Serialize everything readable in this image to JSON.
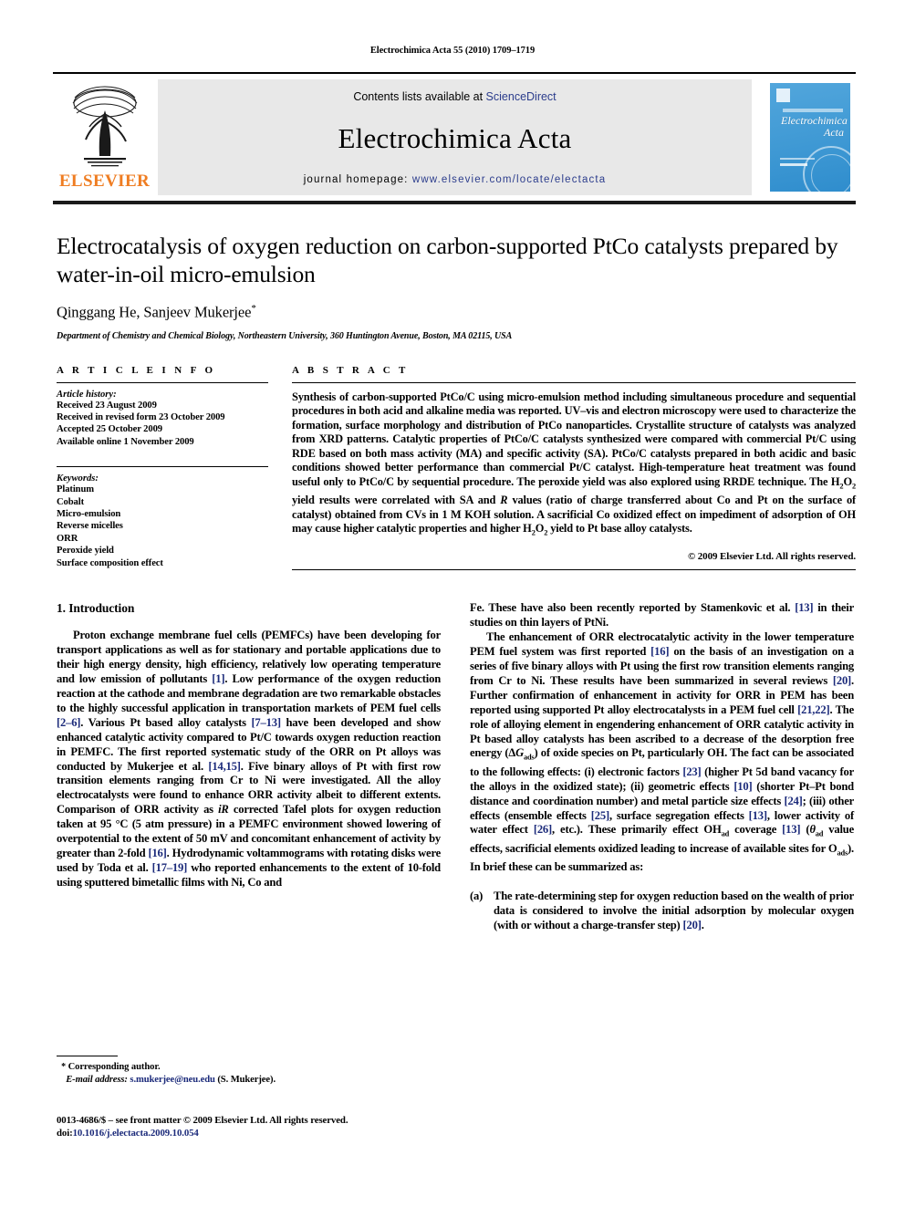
{
  "running_head": "Electrochimica Acta 55 (2010) 1709–1719",
  "masthead": {
    "publisher_name": "ELSEVIER",
    "contents_prefix": "Contents lists available at ",
    "contents_link": "ScienceDirect",
    "journal_title": "Electrochimica Acta",
    "homepage_prefix": "journal homepage: ",
    "homepage_url": "www.elsevier.com/locate/electacta",
    "cover_title_line1": "Electrochimica",
    "cover_title_line2": "Acta"
  },
  "article": {
    "title": "Electrocatalysis of oxygen reduction on carbon-supported PtCo catalysts prepared by water-in-oil micro-emulsion",
    "authors": "Qinggang He, Sanjeev Mukerjee",
    "corresponding_marker": "*",
    "affiliation": "Department of Chemistry and Chemical Biology, Northeastern University, 360 Huntington Avenue, Boston, MA 02115, USA"
  },
  "article_info": {
    "heading": "A R T I C L E   I N F O",
    "history_label": "Article history:",
    "history": [
      "Received 23 August 2009",
      "Received in revised form 23 October 2009",
      "Accepted 25 October 2009",
      "Available online 1 November 2009"
    ],
    "keywords_label": "Keywords:",
    "keywords": [
      "Platinum",
      "Cobalt",
      "Micro-emulsion",
      "Reverse micelles",
      "ORR",
      "Peroxide yield",
      "Surface composition effect"
    ]
  },
  "abstract": {
    "heading": "A B S T R A C T",
    "copyright": "© 2009 Elsevier Ltd. All rights reserved."
  },
  "introduction": {
    "heading": "1.  Introduction",
    "list_marker": "(a)"
  },
  "footnote": {
    "corresponding_star": "*",
    "corresponding_label": "Corresponding author.",
    "email_label": "E-mail address:",
    "email": "s.mukerjee@neu.edu",
    "email_suffix": "(S. Mukerjee)."
  },
  "imprint": {
    "issn_line": "0013-4686/$ – see front matter © 2009 Elsevier Ltd. All rights reserved.",
    "doi_prefix": "doi:",
    "doi": "10.1016/j.electacta.2009.10.054"
  },
  "colors": {
    "link": "#2b3c8c",
    "citation": "#1b2a7a",
    "elsevier_orange": "#ef7d22",
    "band_gray": "#e8e8e8",
    "cover_blue": "#3f99d4"
  }
}
